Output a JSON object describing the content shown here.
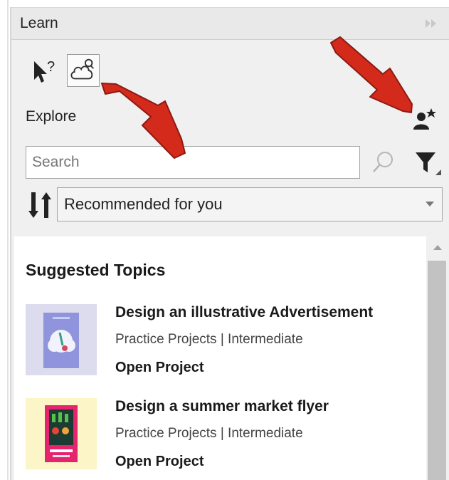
{
  "panel": {
    "title": "Learn"
  },
  "toolbar": {
    "explore_label": "Explore"
  },
  "search": {
    "placeholder": "Search"
  },
  "sort": {
    "selected": "Recommended for you"
  },
  "content": {
    "section_title": "Suggested Topics",
    "items": [
      {
        "title": "Design an illustrative Advertisement",
        "meta": "Practice Projects | Intermediate",
        "action": "Open Project"
      },
      {
        "title": "Design a summer market flyer",
        "meta": "Practice Projects | Intermediate",
        "action": "Open Project"
      }
    ]
  },
  "colors": {
    "annotation_arrow": "#d42a1b",
    "panel_bg": "#f0f0f0"
  },
  "icons": [
    "collapse-icon",
    "help-cursor-icon",
    "cloud-search-icon",
    "person-star-icon",
    "search-icon",
    "filter-icon",
    "sort-icon",
    "chevron-down-icon"
  ]
}
